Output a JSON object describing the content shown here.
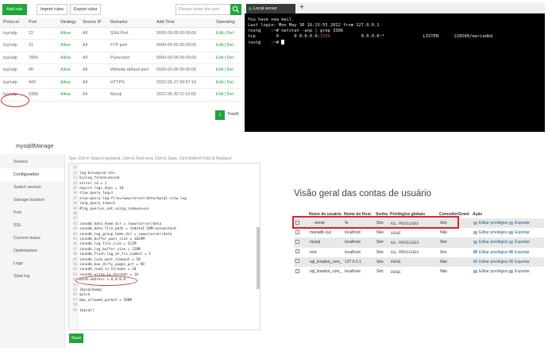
{
  "firewall": {
    "buttons": {
      "add_rule": "Add rule",
      "import_rules": "Import rules",
      "export_rules": "Export rules"
    },
    "search": {
      "placeholder": "Please enter the port"
    },
    "columns": [
      "Protocol",
      "Port",
      "Strategy",
      "Source IP",
      "Remarks",
      "Add Time",
      "Operating"
    ],
    "rows": [
      {
        "protocol": "tcp/udp",
        "port": "22",
        "strategy": "Allow",
        "source": "All",
        "remarks": "SSH Port",
        "time": "0000-00-00 00:00:00",
        "ops": "Edit | Del"
      },
      {
        "protocol": "tcp/udp",
        "port": "21",
        "strategy": "Allow",
        "source": "All",
        "remarks": "FTP port",
        "time": "0000-00-00 00:00:00",
        "ops": "Edit | Del"
      },
      {
        "protocol": "tcp/udp",
        "port": "7800",
        "strategy": "Allow",
        "source": "All",
        "remarks": "Panel port",
        "time": "0000-00-00 00:00:00",
        "ops": "Edit | Del"
      },
      {
        "protocol": "tcp/udp",
        "port": "80",
        "strategy": "Allow",
        "source": "All",
        "remarks": "Website default port",
        "time": "0000-00-00 00:00:00",
        "ops": "Edit | Del"
      },
      {
        "protocol": "tcp/udp",
        "port": "443",
        "strategy": "Allow",
        "source": "All",
        "remarks": "HTTPS",
        "time": "2022-05-27 09:57:16",
        "ops": "Edit | Del"
      },
      {
        "protocol": "tcp/udp",
        "port": "3306",
        "strategy": "Allow",
        "source": "All",
        "remarks": "Mysql",
        "time": "2022-05-30 11:10:03",
        "ops": "Edit | Del"
      }
    ],
    "pagination": {
      "page": "1",
      "total_label": "Total6"
    }
  },
  "terminal": {
    "tab_label": "Local server",
    "plus": "+",
    "lines": {
      "l1": "You have new mail.",
      "l2": "Last login: Mon May 30 16:15:55 2022 from 127.0.0.1",
      "l3": "root@    :~# netstat -anp | grep 3306",
      "l4_a": "tcp        0      0 0.0.0.0:",
      "l4_port": "3306",
      "l4_b": "            0.0.0.0:*               LISTEN      228560/mariadbd",
      "l5": "root@    :~# "
    }
  },
  "mysqld": {
    "title": "mysqldManage",
    "sidebar": [
      "Service",
      "Configuration",
      "Switch version",
      "Storage location",
      "Port",
      "SSL",
      "Current status",
      "Optimization",
      "Logs",
      "Slow log"
    ],
    "tips": "Tips:  Ctrl+F Search keyword,  Ctrl+G Find next,  Ctrl+S Save,  Ctrl+Shift+R Find & Replace!",
    "config_lines": [
      {
        "n": "30",
        "t": ""
      },
      {
        "n": "31",
        "t": ""
      },
      {
        "n": "32",
        "t": "log-bin=mysql-bin"
      },
      {
        "n": "33",
        "t": "binlog_format=mixed"
      },
      {
        "n": "34",
        "t": "server-id = 1"
      },
      {
        "n": "35",
        "t": "expire_logs_days = 10"
      },
      {
        "n": "36",
        "t": "slow_query_log=1"
      },
      {
        "n": "37",
        "t": "slow-query-log-file=/www/server/data/mysql-slow.log"
      },
      {
        "n": "38",
        "t": "long_query_time=3"
      },
      {
        "n": "39",
        "t": "#log_queries_not_using_indexes=on"
      },
      {
        "n": "40",
        "t": ""
      },
      {
        "n": "41",
        "t": ""
      },
      {
        "n": "42",
        "t": "innodb_data_home_dir = /www/server/data"
      },
      {
        "n": "43",
        "t": "innodb_data_file_path = ibdata1:10M:autoextend"
      },
      {
        "n": "44",
        "t": "innodb_log_group_home_dir = /www/server/data"
      },
      {
        "n": "45",
        "t": "innodb_buffer_pool_size = 1024M"
      },
      {
        "n": "46",
        "t": "innodb_log_file_size = 512M"
      },
      {
        "n": "47",
        "t": "innodb_log_buffer_size = 128M"
      },
      {
        "n": "48",
        "t": "innodb_flush_log_at_trx_commit = 1"
      },
      {
        "n": "49",
        "t": "innodb_lock_wait_timeout = 50"
      },
      {
        "n": "50",
        "t": "innodb_max_dirty_pages_pct = 90"
      },
      {
        "n": "51",
        "t": "innodb_read_io_threads = 18"
      },
      {
        "n": "52",
        "t": "innodb_write_io_threads = 18"
      },
      {
        "n": "53",
        "t": "bind-address = 0.0.0.0"
      },
      {
        "n": "54",
        "t": ""
      },
      {
        "n": "55",
        "t": "[mysqldump]"
      },
      {
        "n": "56",
        "t": "quick"
      },
      {
        "n": "57",
        "t": "max_allowed_packet = 500M"
      },
      {
        "n": "58",
        "t": ""
      },
      {
        "n": "59",
        "t": "[mysql]"
      }
    ],
    "save_label": "Save"
  },
  "pma": {
    "title": "Visão geral das contas de usuário",
    "columns": [
      "Nome do usuário",
      "Nome do Host",
      "Senha",
      "Privilégios globais",
      "Conceder/Grant",
      "Ação"
    ],
    "rows": [
      {
        "user": "remot",
        "host": "%",
        "pw": "Sim",
        "priv": "ALL PRIVILEGES",
        "grant": "Sim",
        "edit": "Editar privilégios",
        "export": "Exportar"
      },
      {
        "user": "mariadb.sys",
        "host": "localhost",
        "pw": "Não",
        "priv": "USAGE",
        "grant": "Não",
        "edit": "Editar privilégios",
        "export": "Exportar"
      },
      {
        "user": "mysql",
        "host": "localhost",
        "pw": "Sim",
        "priv": "ALL PRIVILEGES",
        "grant": "Sim",
        "edit": "Editar privilégios",
        "export": "Exportar"
      },
      {
        "user": "root",
        "host": "localhost",
        "pw": "Sim",
        "priv": "ALL PRIVILEGES",
        "grant": "Sim",
        "edit": "Editar privilégios",
        "export": "Exportar"
      },
      {
        "user": "sql_limabot_com_",
        "host": "127.0.0.1",
        "pw": "Sim",
        "priv": "USAGE",
        "grant": "Não",
        "edit": "Editar privilégios",
        "export": "Exportar"
      },
      {
        "user": "sql_limabot_com_",
        "host": "localhost",
        "pw": "Sim",
        "priv": "USAGE",
        "grant": "Não",
        "edit": "Editar privilégios",
        "export": "Exportar"
      }
    ]
  },
  "colors": {
    "accent": "#20a53a",
    "annotation": "#e21f2b",
    "terminal_bg": "#000000"
  }
}
